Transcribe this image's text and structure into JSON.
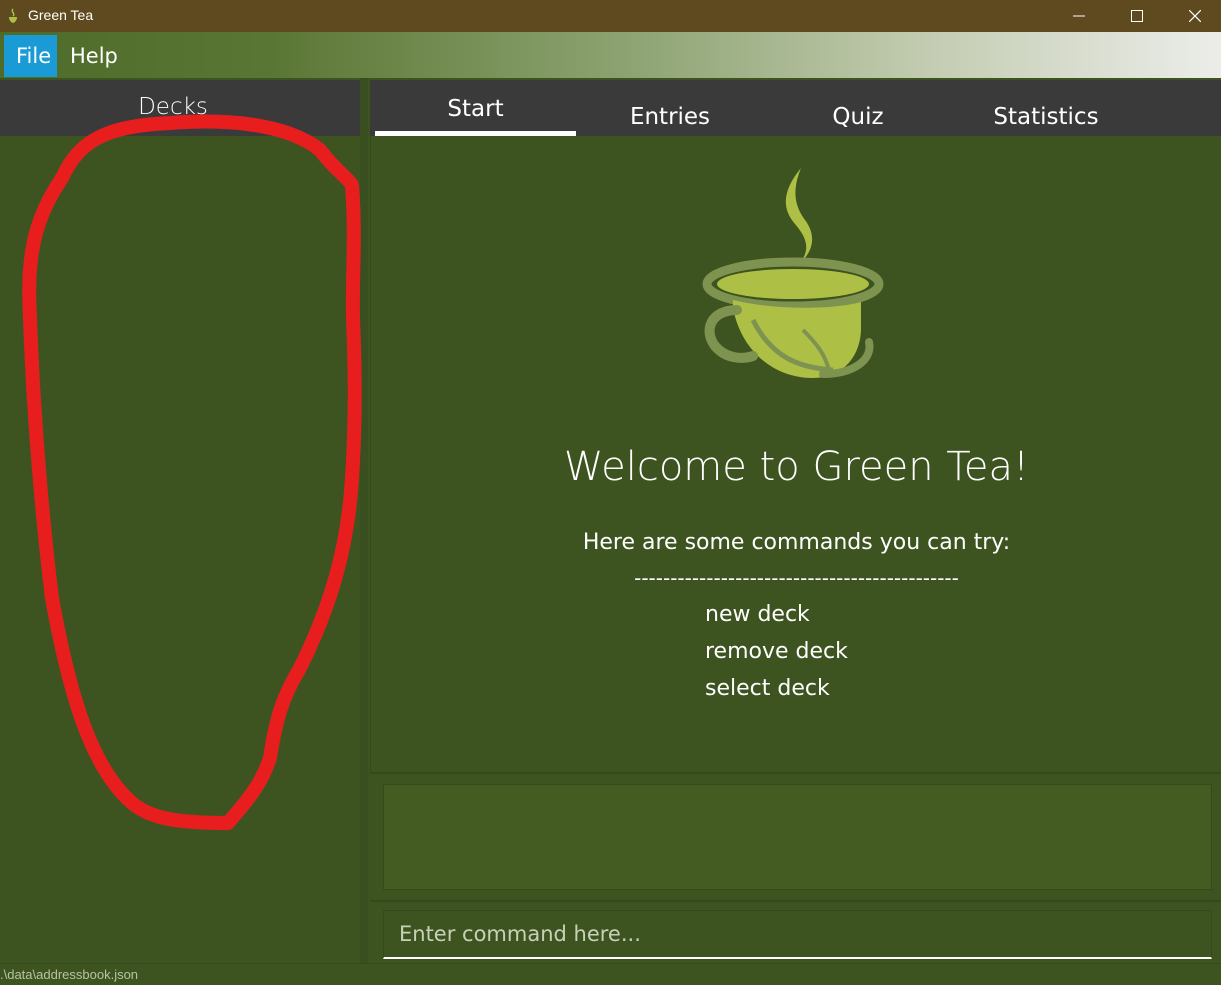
{
  "window": {
    "title": "Green Tea",
    "icon": "tea-leaf-icon"
  },
  "menu": {
    "file": "File",
    "help": "Help"
  },
  "sidebar": {
    "title": "Decks",
    "items": []
  },
  "tabs": [
    {
      "label": "Start",
      "selected": true
    },
    {
      "label": "Entries",
      "selected": false
    },
    {
      "label": "Quiz",
      "selected": false
    },
    {
      "label": "Statistics",
      "selected": false
    }
  ],
  "start": {
    "logo": "tea-cup-icon",
    "welcome": "Welcome to Green Tea!",
    "hint": "Here are some commands you can try:",
    "rule": "---------------------------------------------",
    "commands": [
      "new deck",
      "remove deck",
      "select deck"
    ]
  },
  "result": {
    "text": ""
  },
  "command": {
    "placeholder": "Enter command here..."
  },
  "status": {
    "path": ".\\data\\addressbook.json"
  },
  "colors": {
    "background": "#3d5420",
    "titlebar": "#5e4a1e",
    "menu_selected": "#1a9bd6",
    "header": "#3a3a3a",
    "annotation": "#e81e1e",
    "logo_light": "#aebf46",
    "logo_dark": "#7f9350"
  }
}
